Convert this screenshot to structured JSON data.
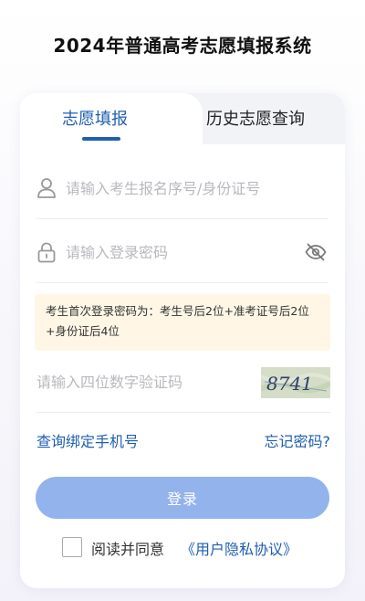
{
  "page": {
    "title": "2024年普通高考志愿填报系统"
  },
  "tabs": [
    {
      "label": "志愿填报",
      "active": true
    },
    {
      "label": "历史志愿查询",
      "active": false
    }
  ],
  "form": {
    "username": {
      "placeholder": "请输入考生报名序号/身份证号",
      "value": "",
      "icon": "user-icon"
    },
    "password": {
      "placeholder": "请输入登录密码",
      "value": "",
      "icon": "lock-icon",
      "toggle_icon": "eye-off-icon"
    },
    "tip": "考生首次登录密码为：考生号后2位+准考证号后2位+身份证后4位",
    "captcha": {
      "placeholder": "请输入四位数字验证码",
      "value": "",
      "image_text": "8741"
    }
  },
  "links": {
    "bind_phone": "查询绑定手机号",
    "forgot_password": "忘记密码?"
  },
  "login_button": "登录",
  "agreement": {
    "checked": false,
    "text": "阅读并同意",
    "link": "《用户隐私协议》"
  },
  "colors": {
    "accent": "#1f5fb0",
    "button": "#93b3ec",
    "tip_background": "#fff6e6"
  }
}
